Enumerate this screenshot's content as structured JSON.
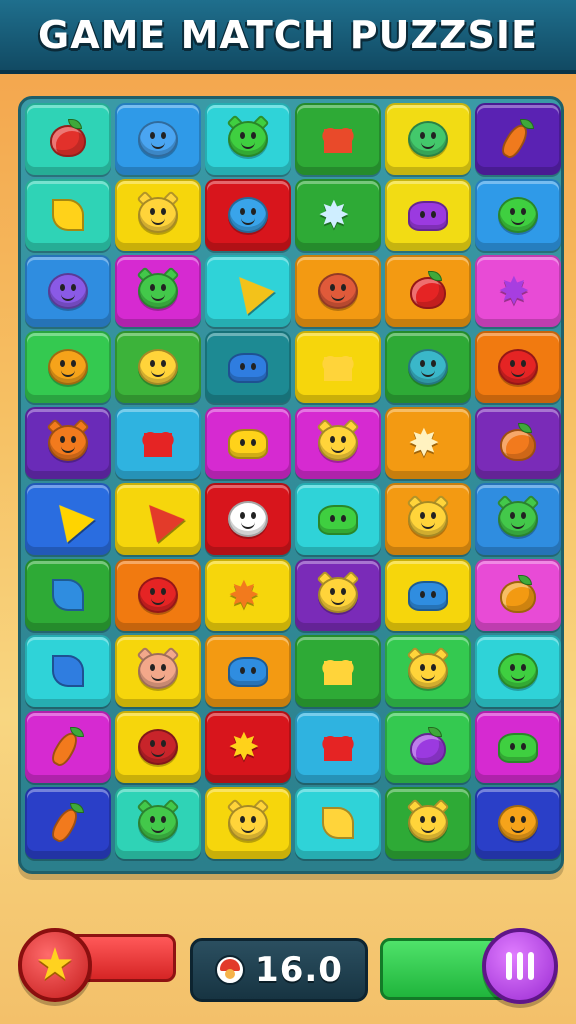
{
  "header": {
    "title": "GAME MATCH PUZZSIE"
  },
  "hud": {
    "score": "16.0",
    "star_icon": "star-icon",
    "pause_icon": "pause-icon"
  },
  "colors": {
    "header": "#1a5f7a",
    "board": "#2f8c98",
    "accent_red": "#e02e2e",
    "accent_green": "#2fc84b",
    "accent_purple": "#b84ae6"
  },
  "board": {
    "rows": [
      [
        {
          "bg": "#2fd3b6",
          "icon": "strawberry",
          "c": "#e2312b"
        },
        {
          "bg": "#2f9ae8",
          "icon": "blue-creature",
          "c": "#4aa5f2"
        },
        {
          "bg": "#2fd3d8",
          "icon": "green-cat",
          "c": "#3fcf40"
        },
        {
          "bg": "#2eaa36",
          "icon": "heart-fruit",
          "c": "#e94a2a"
        },
        {
          "bg": "#f2dc14",
          "icon": "green-robot",
          "c": "#43c86b"
        },
        {
          "bg": "#5a22b3",
          "icon": "carrot",
          "c": "#f07a1d"
        }
      ],
      [
        {
          "bg": "#2fd3b6",
          "icon": "yellow-drop",
          "c": "#ffd21a"
        },
        {
          "bg": "#f6d60c",
          "icon": "yellow-cat",
          "c": "#ffd43a"
        },
        {
          "bg": "#d8151c",
          "icon": "blue-bird",
          "c": "#39a4ea"
        },
        {
          "bg": "#2eaa36",
          "icon": "star-gem",
          "c": "#cfeeff"
        },
        {
          "bg": "#f2dc14",
          "icon": "purple-blob",
          "c": "#9b3ae0"
        },
        {
          "bg": "#2f9ae8",
          "icon": "green-face",
          "c": "#3fcf40"
        }
      ],
      [
        {
          "bg": "#2f8de0",
          "icon": "purple-face",
          "c": "#8a5ae6"
        },
        {
          "bg": "#d62ad1",
          "icon": "green-cat",
          "c": "#43c84a"
        },
        {
          "bg": "#2fd3d8",
          "icon": "pencil",
          "c": "#f3c21a"
        },
        {
          "bg": "#f39a12",
          "icon": "tomato-face",
          "c": "#e05a3a"
        },
        {
          "bg": "#f39a12",
          "icon": "apple",
          "c": "#e52424"
        },
        {
          "bg": "#e84bd6",
          "icon": "flower",
          "c": "#a73ee0"
        }
      ],
      [
        {
          "bg": "#34c950",
          "icon": "orange-creature",
          "c": "#f6a31a"
        },
        {
          "bg": "#3cb33a",
          "icon": "yellow-face",
          "c": "#ffd43a"
        },
        {
          "bg": "#1d8a93",
          "icon": "blue-blob",
          "c": "#2f7de0"
        },
        {
          "bg": "#f6d60c",
          "icon": "yellow-heart",
          "c": "#ffd43a"
        },
        {
          "bg": "#2eaa36",
          "icon": "teal-face",
          "c": "#3ab7c9"
        },
        {
          "bg": "#f17a10",
          "icon": "red-bug",
          "c": "#e52424"
        }
      ],
      [
        {
          "bg": "#6a2bb8",
          "icon": "orange-cat",
          "c": "#f27a1d"
        },
        {
          "bg": "#2fb3e0",
          "icon": "red-heart",
          "c": "#e52424"
        },
        {
          "bg": "#d62ad1",
          "icon": "yellow-blob",
          "c": "#ffd21a"
        },
        {
          "bg": "#d62ad1",
          "icon": "yellow-cat",
          "c": "#ffd43a"
        },
        {
          "bg": "#f39a12",
          "icon": "crown-splash",
          "c": "#fff2c0"
        },
        {
          "bg": "#7a2bb8",
          "icon": "orange-fruit",
          "c": "#f27a1d"
        }
      ],
      [
        {
          "bg": "#2a6de0",
          "icon": "arrow",
          "c": "#ffd400"
        },
        {
          "bg": "#f6d60c",
          "icon": "play-arrow",
          "c": "#e33b2a"
        },
        {
          "bg": "#d8151c",
          "icon": "white-face",
          "c": "#ffffff"
        },
        {
          "bg": "#2fd3d8",
          "icon": "green-slime",
          "c": "#3fcf40"
        },
        {
          "bg": "#f39a12",
          "icon": "yellow-cat",
          "c": "#ffd43a"
        },
        {
          "bg": "#2f8de0",
          "icon": "green-cat",
          "c": "#43c84a"
        }
      ],
      [
        {
          "bg": "#2eaa36",
          "icon": "blue-leaf",
          "c": "#2f8de0"
        },
        {
          "bg": "#f17a10",
          "icon": "red-heart-face",
          "c": "#e52424"
        },
        {
          "bg": "#f6d60c",
          "icon": "orange-sun",
          "c": "#f27a1d"
        },
        {
          "bg": "#7a2bb8",
          "icon": "yellow-cat",
          "c": "#ffd43a"
        },
        {
          "bg": "#f6d60c",
          "icon": "blue-shield",
          "c": "#2f8de0"
        },
        {
          "bg": "#e84bd6",
          "icon": "pumpkin",
          "c": "#f39a12"
        }
      ],
      [
        {
          "bg": "#2fd3d8",
          "icon": "blue-balloon",
          "c": "#2f7de0"
        },
        {
          "bg": "#f6d60c",
          "icon": "pink-bear",
          "c": "#f3a88a"
        },
        {
          "bg": "#f39a12",
          "icon": "blue-fish",
          "c": "#2f8de0"
        },
        {
          "bg": "#2eaa36",
          "icon": "yellow-heart",
          "c": "#ffd43a"
        },
        {
          "bg": "#34c950",
          "icon": "yellow-cat",
          "c": "#ffd43a"
        },
        {
          "bg": "#2fd3d8",
          "icon": "green-face",
          "c": "#3fcf40"
        }
      ],
      [
        {
          "bg": "#d62ad1",
          "icon": "carrot",
          "c": "#f27a1d"
        },
        {
          "bg": "#f6d60c",
          "icon": "red-face",
          "c": "#c8242a"
        },
        {
          "bg": "#d8151c",
          "icon": "yellow-crown",
          "c": "#ffd21a"
        },
        {
          "bg": "#2fb3e0",
          "icon": "red-heart",
          "c": "#e52424"
        },
        {
          "bg": "#34c950",
          "icon": "purple-apple",
          "c": "#9b3ae0"
        },
        {
          "bg": "#d62ad1",
          "icon": "green-slime",
          "c": "#3fcf40"
        }
      ],
      [
        {
          "bg": "#2a3fc8",
          "icon": "carrot",
          "c": "#f27a1d"
        },
        {
          "bg": "#2fd3b6",
          "icon": "green-cat",
          "c": "#43c84a"
        },
        {
          "bg": "#f6d60c",
          "icon": "yellow-cat",
          "c": "#ffd43a"
        },
        {
          "bg": "#2fd3d8",
          "icon": "yellow-leaf",
          "c": "#ffd43a"
        },
        {
          "bg": "#2eaa36",
          "icon": "yellow-cat",
          "c": "#ffd43a"
        },
        {
          "bg": "#2a3fc8",
          "icon": "orange-face",
          "c": "#f6a31a"
        }
      ]
    ]
  }
}
